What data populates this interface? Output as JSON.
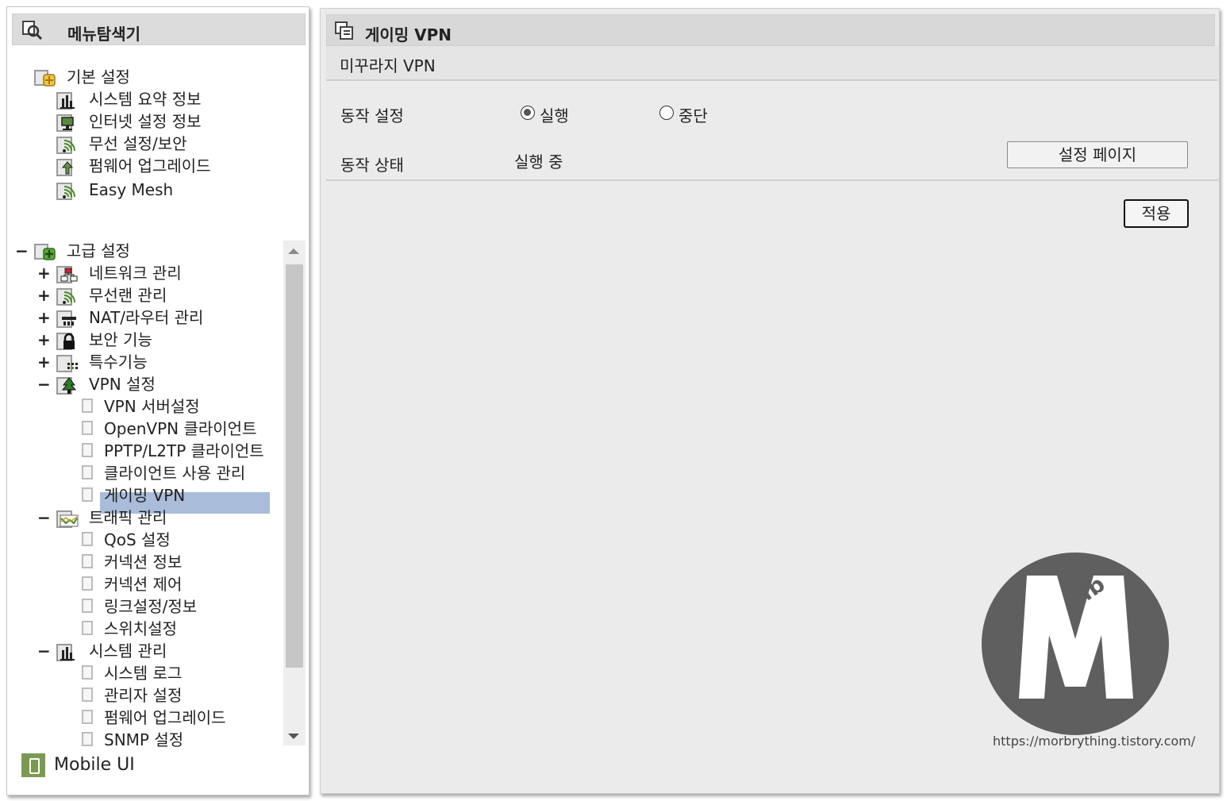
{
  "menu": {
    "title": "메뉴탐색기",
    "basic": {
      "label": "기본 설정",
      "items": [
        "시스템 요약 정보",
        "인터넷 설정 정보",
        "무선 설정/보안",
        "펌웨어 업그레이드",
        "Easy Mesh"
      ]
    },
    "advanced": {
      "toggle": "−",
      "label": "고급 설정",
      "groups": [
        {
          "toggle": "+",
          "label": "네트워크 관리"
        },
        {
          "toggle": "+",
          "label": "무선랜 관리"
        },
        {
          "toggle": "+",
          "label": "NAT/라우터 관리"
        },
        {
          "toggle": "+",
          "label": "보안 기능"
        },
        {
          "toggle": "+",
          "label": "특수기능"
        },
        {
          "toggle": "−",
          "label": "VPN 설정",
          "children": [
            "VPN 서버설정",
            "OpenVPN 클라이언트",
            "PPTP/L2TP 클라이언트",
            "클라이언트 사용 관리",
            "게이밍 VPN"
          ]
        },
        {
          "toggle": "−",
          "label": "트래픽 관리",
          "children": [
            "QoS 설정",
            "커넥션 정보",
            "커넥션 제어",
            "링크설정/정보",
            "스위치설정"
          ]
        },
        {
          "toggle": "−",
          "label": "시스템 관리",
          "children": [
            "시스템 로그",
            "관리자 설정",
            "펌웨어 업그레이드",
            "SNMP 설정"
          ]
        }
      ]
    },
    "mobile_ui": "Mobile UI"
  },
  "content": {
    "title": "게이밍 VPN",
    "section": "미꾸라지 VPN",
    "operation_label": "동작 설정",
    "radio_run": "실행",
    "radio_stop": "중단",
    "selected": "실행",
    "status_label": "동작 상태",
    "status_value": "실행 중",
    "settings_button": "설정 페이지",
    "apply_button": "적용"
  },
  "watermark": {
    "letters": "Mb",
    "url": "https://morbrything.tistory.com/"
  },
  "colors": {
    "selection": "#a9bcd9",
    "panel_bg": "#ebebeb",
    "header_bg": "#d8d8d8",
    "watermark_circle": "#5f5f5f"
  }
}
